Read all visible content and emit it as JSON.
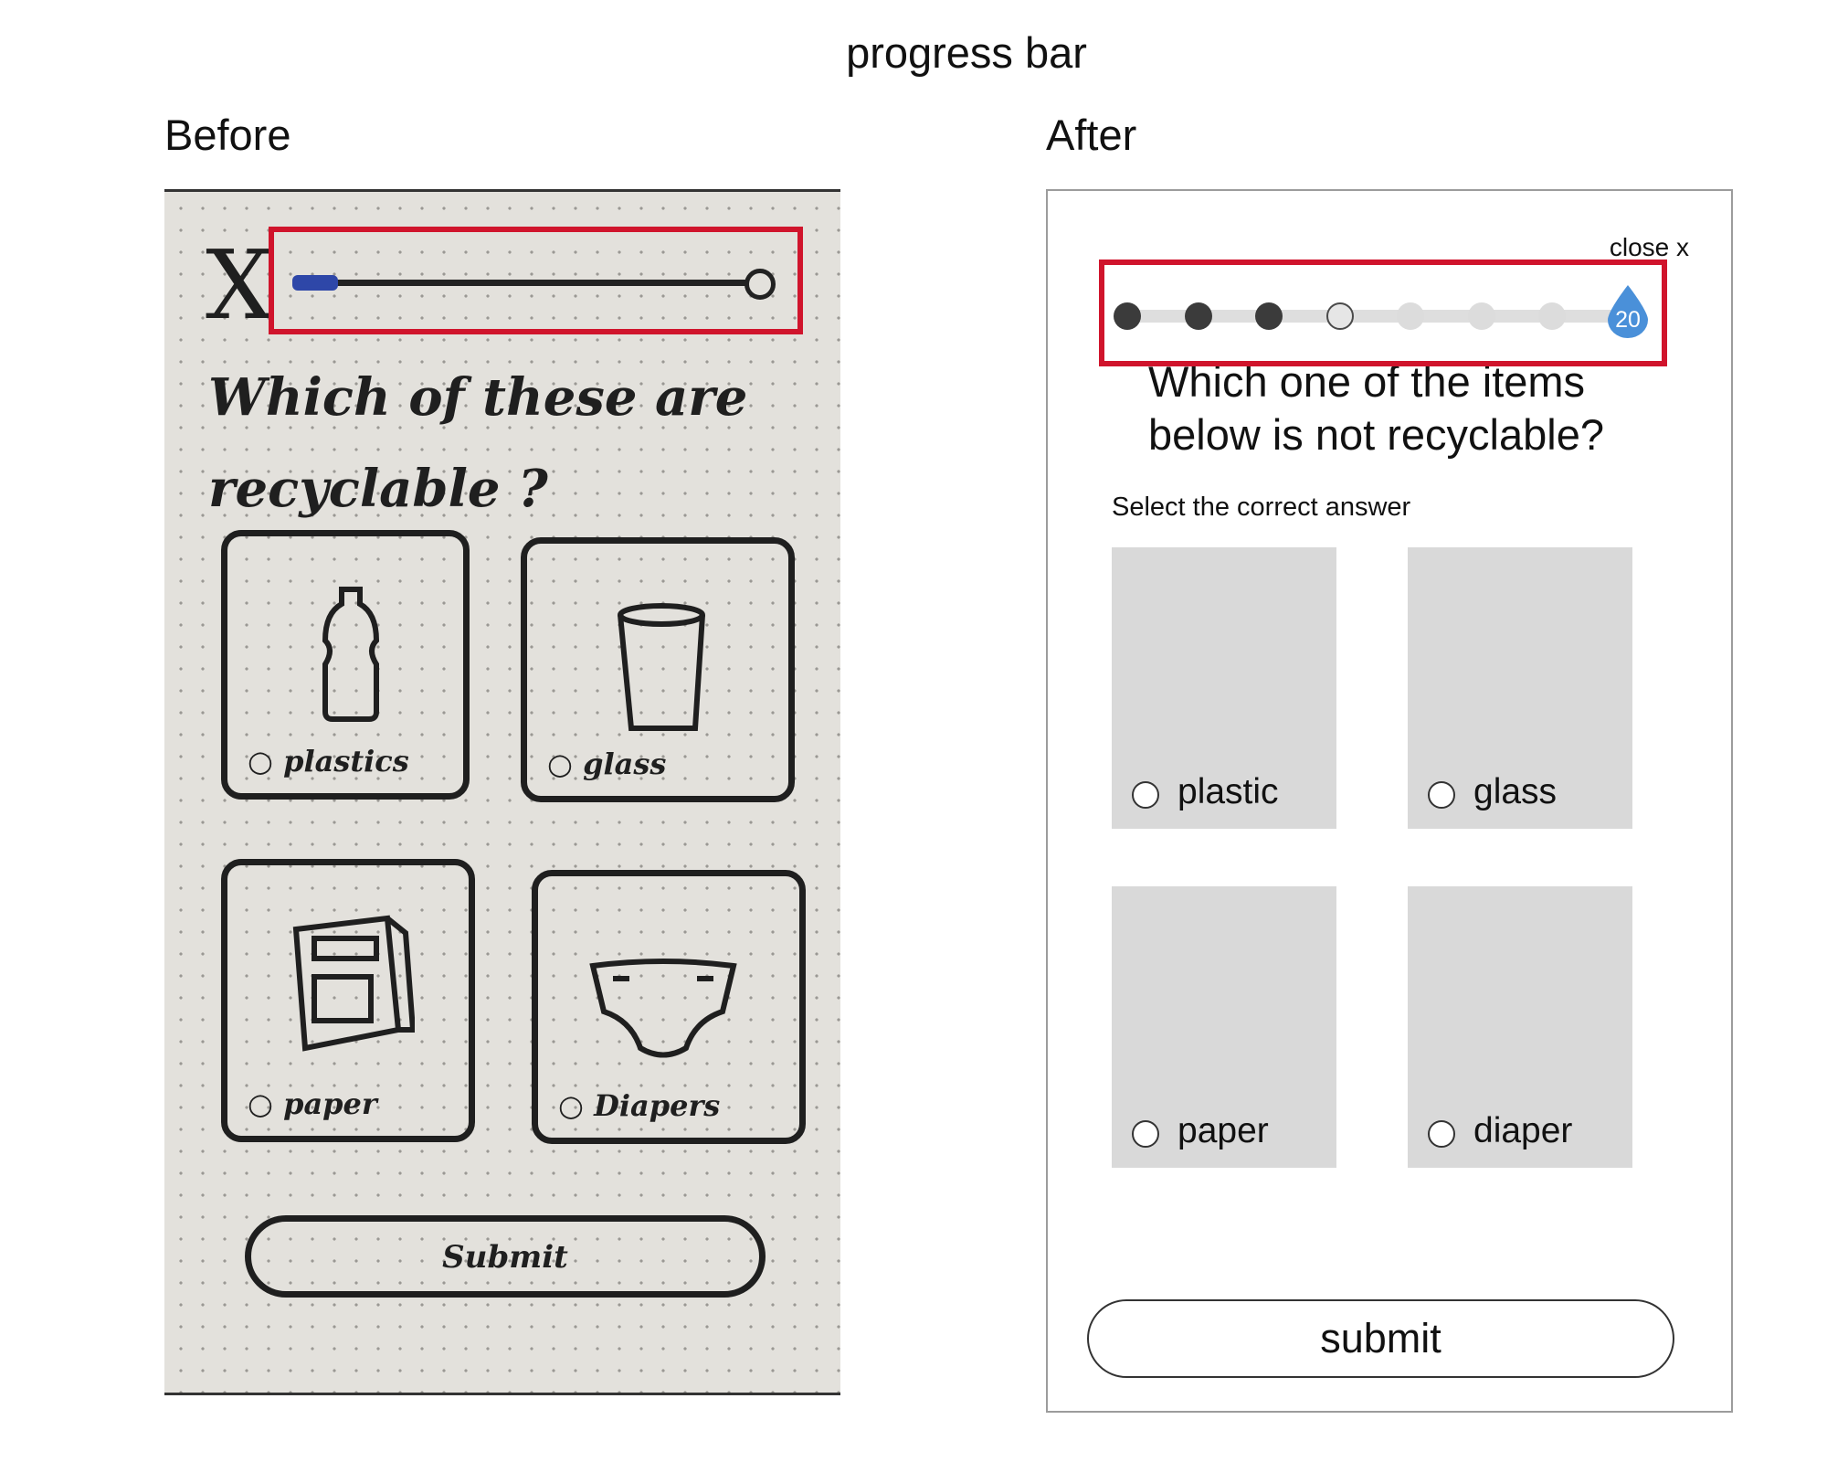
{
  "page": {
    "title": "progress bar",
    "before_label": "Before",
    "after_label": "After"
  },
  "colors": {
    "highlight": "#d0142c",
    "progress_accent": "#4a90d9",
    "sketch_progress_fill": "#2e47a8",
    "option_card_bg": "#d9d9d9"
  },
  "before": {
    "close_glyph": "X",
    "progress_fraction": 0.1,
    "question": "Which of these are recyclable ?",
    "options": [
      {
        "label": "plastics",
        "icon": "bottle-icon"
      },
      {
        "label": "glass",
        "icon": "cup-icon"
      },
      {
        "label": "paper",
        "icon": "carton-icon"
      },
      {
        "label": "Diapers",
        "icon": "diaper-icon"
      }
    ],
    "submit_label": "Submit"
  },
  "after": {
    "close_label": "close x",
    "progress": {
      "steps_total": 8,
      "steps_completed": 3,
      "current_step": 4,
      "end_badge_value": "20",
      "end_badge_icon": "water-drop-icon"
    },
    "question": "Which one of the items below is not recyclable?",
    "instruction": "Select the correct answer",
    "options": [
      {
        "label": "plastic"
      },
      {
        "label": "glass"
      },
      {
        "label": "paper"
      },
      {
        "label": "diaper"
      }
    ],
    "submit_label": "submit"
  }
}
